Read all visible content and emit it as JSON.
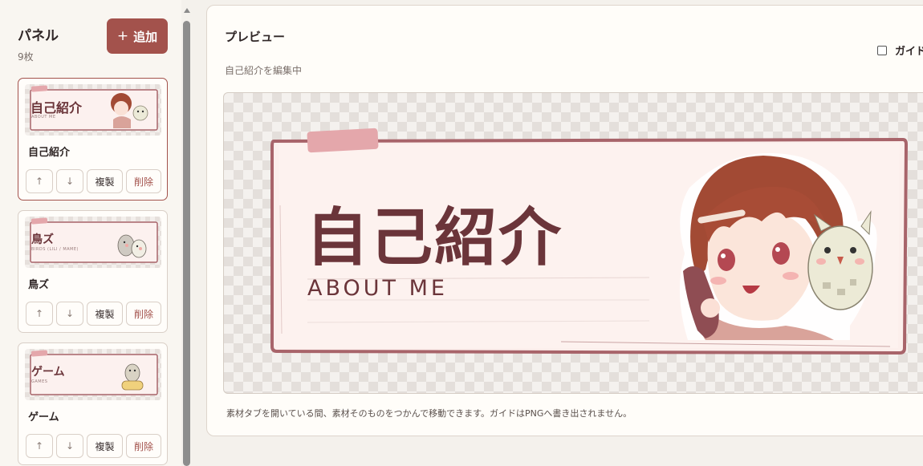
{
  "sidebar": {
    "title": "パネル",
    "count": "9枚",
    "add_button": {
      "icon": "+",
      "label": "追加"
    },
    "cards": [
      {
        "name": "自己紹介",
        "thumb_title": "自己紹介",
        "thumb_sub": "ABOUT ME",
        "up": "↑",
        "down": "↓",
        "duplicate": "複製",
        "delete": "削除"
      },
      {
        "name": "鳥ズ",
        "thumb_title": "鳥ズ",
        "thumb_sub": "BIRDS (LILI / MAME)",
        "up": "↑",
        "down": "↓",
        "duplicate": "複製",
        "delete": "削除"
      },
      {
        "name": "ゲーム",
        "thumb_title": "ゲーム",
        "thumb_sub": "GAMES",
        "up": "↑",
        "down": "↓",
        "duplicate": "複製",
        "delete": "削除"
      }
    ]
  },
  "preview": {
    "title": "プレビュー",
    "subtitle": "自己紹介を編集中",
    "guide_label": "ガイド",
    "banner_title": "自己紹介",
    "banner_subtitle": "ABOUT ME",
    "note": "素材タブを開いている間、素材そのものをつかんで移動できます。ガイドはPNGへ書き出されません。"
  },
  "colors": {
    "accent": "#a3524c",
    "banner_text": "#6b353a",
    "banner_frame": "#a8646a",
    "tape": "#e4a7ab"
  }
}
